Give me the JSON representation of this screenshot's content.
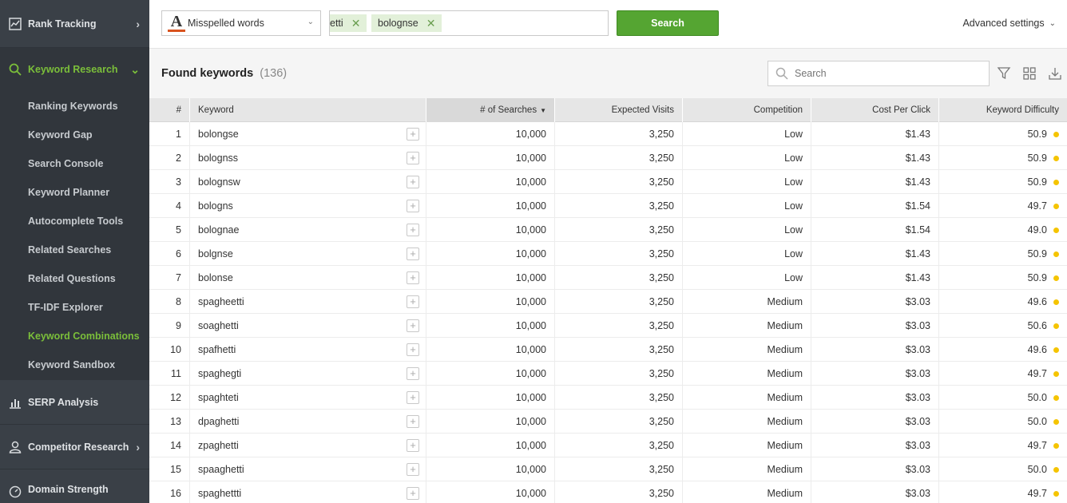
{
  "sidebar": {
    "rank_tracking": "Rank Tracking",
    "keyword_research": "Keyword Research",
    "sub_items": [
      {
        "label": "Ranking Keywords",
        "active": false
      },
      {
        "label": "Keyword Gap",
        "active": false
      },
      {
        "label": "Search Console",
        "active": false
      },
      {
        "label": "Keyword Planner",
        "active": false
      },
      {
        "label": "Autocomplete Tools",
        "active": false
      },
      {
        "label": "Related Searches",
        "active": false
      },
      {
        "label": "Related Questions",
        "active": false
      },
      {
        "label": "TF-IDF Explorer",
        "active": false
      },
      {
        "label": "Keyword Combinations",
        "active": true
      },
      {
        "label": "Keyword Sandbox",
        "active": false
      }
    ],
    "serp_analysis": "SERP Analysis",
    "competitor_research": "Competitor Research",
    "domain_strength": "Domain Strength"
  },
  "toolbar": {
    "method_label": "Misspelled words",
    "tags": [
      "etti",
      "bolognse"
    ],
    "search_button": "Search",
    "advanced_settings": "Advanced settings"
  },
  "results": {
    "title": "Found keywords",
    "count": "(136)",
    "search_placeholder": "Search"
  },
  "table": {
    "headers": {
      "num": "#",
      "keyword": "Keyword",
      "searches": "# of Searches",
      "visits": "Expected Visits",
      "competition": "Competition",
      "cpc": "Cost Per Click",
      "difficulty": "Keyword Difficulty"
    },
    "rows": [
      {
        "num": "1",
        "keyword": "bolongse",
        "searches": "10,000",
        "visits": "3,250",
        "competition": "Low",
        "cpc": "$1.43",
        "difficulty": "50.9"
      },
      {
        "num": "2",
        "keyword": "bolognss",
        "searches": "10,000",
        "visits": "3,250",
        "competition": "Low",
        "cpc": "$1.43",
        "difficulty": "50.9"
      },
      {
        "num": "3",
        "keyword": "bolognsw",
        "searches": "10,000",
        "visits": "3,250",
        "competition": "Low",
        "cpc": "$1.43",
        "difficulty": "50.9"
      },
      {
        "num": "4",
        "keyword": "bologns",
        "searches": "10,000",
        "visits": "3,250",
        "competition": "Low",
        "cpc": "$1.54",
        "difficulty": "49.7"
      },
      {
        "num": "5",
        "keyword": "bolognae",
        "searches": "10,000",
        "visits": "3,250",
        "competition": "Low",
        "cpc": "$1.54",
        "difficulty": "49.0"
      },
      {
        "num": "6",
        "keyword": "bolgnse",
        "searches": "10,000",
        "visits": "3,250",
        "competition": "Low",
        "cpc": "$1.43",
        "difficulty": "50.9"
      },
      {
        "num": "7",
        "keyword": "bolonse",
        "searches": "10,000",
        "visits": "3,250",
        "competition": "Low",
        "cpc": "$1.43",
        "difficulty": "50.9"
      },
      {
        "num": "8",
        "keyword": "spagheetti",
        "searches": "10,000",
        "visits": "3,250",
        "competition": "Medium",
        "cpc": "$3.03",
        "difficulty": "49.6"
      },
      {
        "num": "9",
        "keyword": "soaghetti",
        "searches": "10,000",
        "visits": "3,250",
        "competition": "Medium",
        "cpc": "$3.03",
        "difficulty": "50.6"
      },
      {
        "num": "10",
        "keyword": "spafhetti",
        "searches": "10,000",
        "visits": "3,250",
        "competition": "Medium",
        "cpc": "$3.03",
        "difficulty": "49.6"
      },
      {
        "num": "11",
        "keyword": "spaghegti",
        "searches": "10,000",
        "visits": "3,250",
        "competition": "Medium",
        "cpc": "$3.03",
        "difficulty": "49.7"
      },
      {
        "num": "12",
        "keyword": "spaghteti",
        "searches": "10,000",
        "visits": "3,250",
        "competition": "Medium",
        "cpc": "$3.03",
        "difficulty": "50.0"
      },
      {
        "num": "13",
        "keyword": "dpaghetti",
        "searches": "10,000",
        "visits": "3,250",
        "competition": "Medium",
        "cpc": "$3.03",
        "difficulty": "50.0"
      },
      {
        "num": "14",
        "keyword": "zpaghetti",
        "searches": "10,000",
        "visits": "3,250",
        "competition": "Medium",
        "cpc": "$3.03",
        "difficulty": "49.7"
      },
      {
        "num": "15",
        "keyword": "spaaghetti",
        "searches": "10,000",
        "visits": "3,250",
        "competition": "Medium",
        "cpc": "$3.03",
        "difficulty": "50.0"
      },
      {
        "num": "16",
        "keyword": "spaghettti",
        "searches": "10,000",
        "visits": "3,250",
        "competition": "Medium",
        "cpc": "$3.03",
        "difficulty": "49.7"
      }
    ]
  },
  "colors": {
    "accent_green": "#55a532",
    "active_nav": "#7bbf3a",
    "sidebar_bg": "#3a4047",
    "difficulty_dot": "#f5c400"
  }
}
